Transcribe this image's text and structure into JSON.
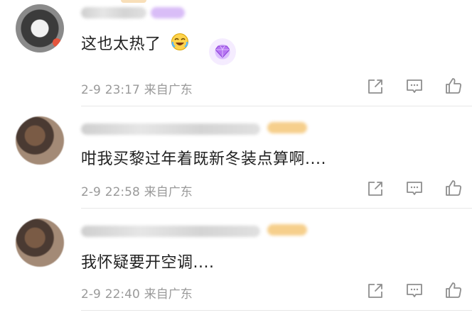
{
  "comments": [
    {
      "text": "这也太热了",
      "date": "2-9",
      "time": "23:17",
      "location": "来自广东"
    },
    {
      "text": "咁我买黎过年着既新冬装点算啊....",
      "date": "2-9",
      "time": "22:58",
      "location": "来自广东"
    },
    {
      "text": "我怀疑要开空调....",
      "date": "2-9",
      "time": "22:40",
      "location": "来自广东"
    }
  ],
  "icons": {
    "share": "share-icon",
    "reply": "comment-icon",
    "like": "thumbs-up-icon",
    "emoji": "laughing-crying-emoji",
    "gem": "purple-gem-badge-icon"
  },
  "colors": {
    "text": "#222222",
    "meta": "#9a9a9a",
    "icon": "#8e8e8e",
    "vip_gold": "#f4c77a",
    "vip_purple": "#c9a6f5"
  }
}
